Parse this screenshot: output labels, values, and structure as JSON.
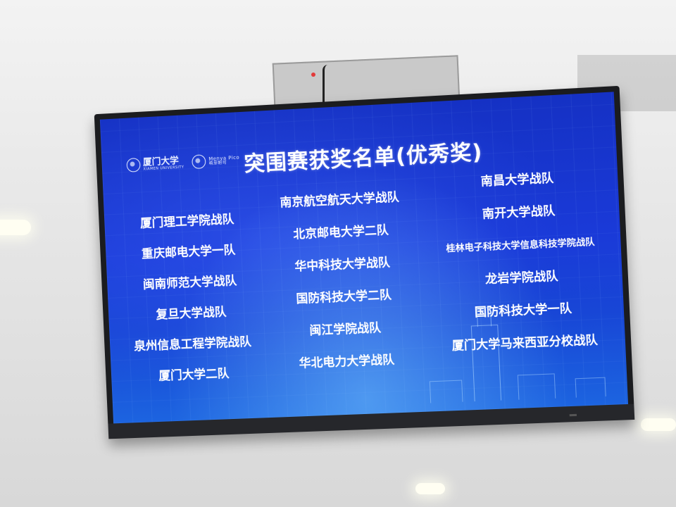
{
  "screen": {
    "title": "突围赛获奖名单(优秀奖)",
    "logos": {
      "university_main": "厦门大学",
      "university_sub": "XIAMEN UNIVERSITY",
      "partner_main": "Menya Pico",
      "partner_sub": "萌芽盼可"
    },
    "column_1": [
      "厦门理工学院战队",
      "重庆邮电大学一队",
      "闽南师范大学战队",
      "复旦大学战队",
      "泉州信息工程学院战队",
      "厦门大学二队"
    ],
    "column_2": [
      "南京航空航天大学战队",
      "北京邮电大学二队",
      "华中科技大学战队",
      "国防科技大学二队",
      "闽江学院战队",
      "华北电力大学战队"
    ],
    "column_3": [
      "南昌大学战队",
      "南开大学战队",
      "桂林电子科技大学信息科技学院战队",
      "龙岩学院战队",
      "国防科技大学一队",
      "厦门大学马来西亚分校战队"
    ]
  }
}
